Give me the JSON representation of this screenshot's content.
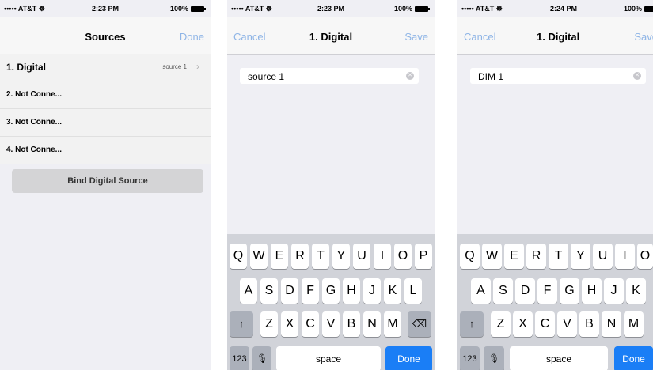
{
  "status": {
    "carrier": "••••• AT&T ☸",
    "battery": "100%",
    "time1": "2:23 PM",
    "time2": "2:23 PM",
    "time3": "2:24 PM"
  },
  "screen1": {
    "title": "Sources",
    "done": "Done",
    "rows": [
      {
        "label": "1. Digital",
        "detail": "source 1"
      },
      {
        "label": "2. Not Conne..."
      },
      {
        "label": "3. Not Conne..."
      },
      {
        "label": "4. Not Conne..."
      }
    ],
    "bind_button": "Bind Digital Source"
  },
  "screen2": {
    "cancel": "Cancel",
    "title": "1. Digital",
    "save": "Save",
    "field_value": "source 1"
  },
  "screen3": {
    "cancel": "Cancel",
    "title": "1. Digital",
    "save": "Save",
    "field_value": "DIM 1"
  },
  "keyboard": {
    "row1": [
      "Q",
      "W",
      "E",
      "R",
      "T",
      "Y",
      "U",
      "I",
      "O",
      "P"
    ],
    "row2": [
      "A",
      "S",
      "D",
      "F",
      "G",
      "H",
      "J",
      "K",
      "L"
    ],
    "row3": [
      "Z",
      "X",
      "C",
      "V",
      "B",
      "N",
      "M"
    ],
    "numbers": "123",
    "space": "space",
    "done": "Done",
    "shift_icon": "↑",
    "delete_icon": "⌫",
    "mic_icon": "Ἱ9"
  },
  "colors": {
    "accent": "#1a7ef6",
    "nav_link": "#8fb5e6"
  }
}
